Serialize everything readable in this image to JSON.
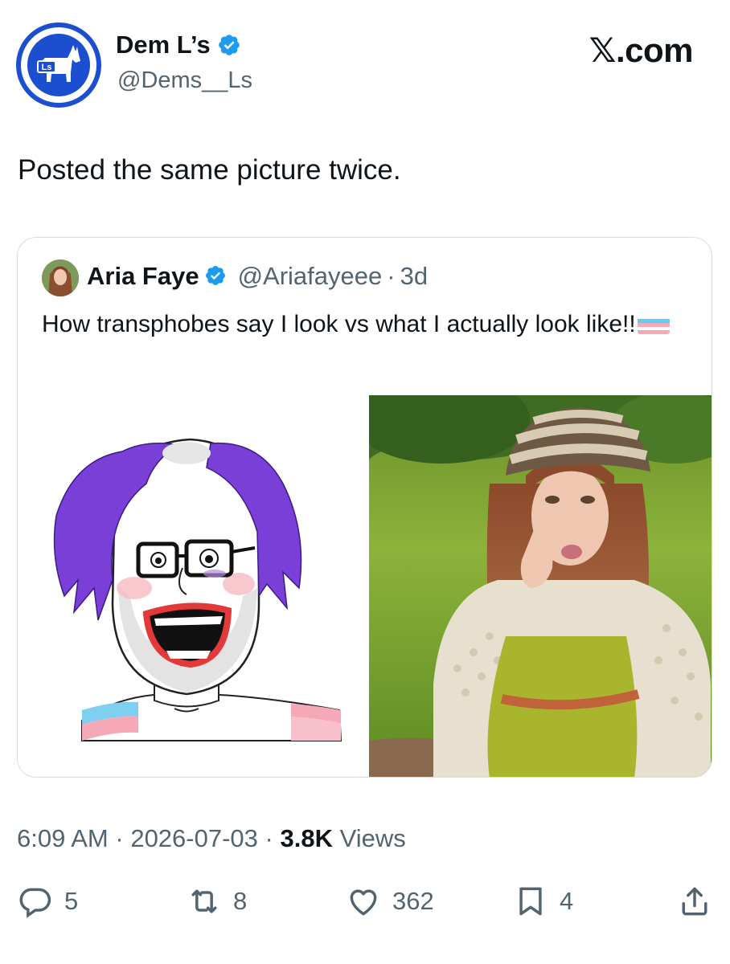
{
  "author": {
    "display_name": "Dem L’s",
    "handle": "@Dems__Ls",
    "avatar_text": "Ls"
  },
  "site_logo": "𝕏.com",
  "tweet": {
    "text": "Posted the same picture twice."
  },
  "quoted_tweet": {
    "display_name": "Aria Faye",
    "handle": "@Ariafayeee",
    "separator": "·",
    "time_ago": "3d",
    "text": "How transphobes say I look vs what I actually look like!!"
  },
  "meta": {
    "time": "6:09 AM",
    "separator": "·",
    "date": "2026-07-03",
    "views_count": "3.8K",
    "views_label": "Views"
  },
  "actions": {
    "replies": "5",
    "reposts": "8",
    "likes": "362",
    "bookmarks": "4"
  },
  "colors": {
    "verified": "#1d9bf0",
    "brand_blue": "#1b4fd0",
    "secondary_text": "#536471",
    "trans_blue": "#5bcefa",
    "trans_pink": "#f5a9b8"
  },
  "icons": {
    "verified": "verified-badge-icon",
    "reply": "reply-icon",
    "repost": "repost-icon",
    "like": "heart-icon",
    "bookmark": "bookmark-icon",
    "share": "share-icon"
  }
}
